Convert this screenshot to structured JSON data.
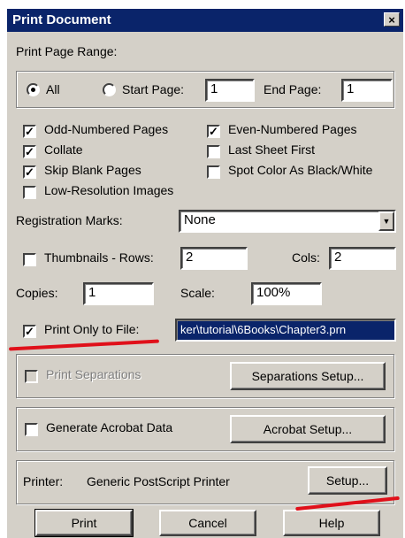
{
  "window": {
    "title": "Print Document",
    "close_glyph": "×"
  },
  "page_range": {
    "title": "Print Page Range:",
    "all_label": "All",
    "start_label": "Start Page:",
    "start_value": "1",
    "end_label": "End Page:",
    "end_value": "1"
  },
  "options": {
    "odd": "Odd-Numbered Pages",
    "even": "Even-Numbered Pages",
    "collate": "Collate",
    "last_sheet": "Last Sheet First",
    "skip_blank": "Skip Blank Pages",
    "spot_color": "Spot Color As Black/White",
    "low_res": "Low-Resolution Images"
  },
  "registration": {
    "label": "Registration Marks:",
    "value": "None"
  },
  "thumbnails": {
    "label": "Thumbnails - Rows:",
    "rows": "2",
    "cols_label": "Cols:",
    "cols": "2"
  },
  "copies": {
    "label": "Copies:",
    "value": "1"
  },
  "scale": {
    "label": "Scale:",
    "value": "100%"
  },
  "print_to_file": {
    "label": "Print Only to File:",
    "path": "ker\\tutorial\\6Books\\Chapter3.prn"
  },
  "separations": {
    "label": "Print Separations",
    "button": "Separations Setup..."
  },
  "acrobat": {
    "label": "Generate Acrobat Data",
    "button": "Acrobat Setup..."
  },
  "printer": {
    "label": "Printer:",
    "name": "Generic PostScript Printer",
    "button": "Setup..."
  },
  "buttons": {
    "print": "Print",
    "cancel": "Cancel",
    "help": "Help"
  },
  "check_glyph": "✓",
  "dropdown_glyph": "▼"
}
